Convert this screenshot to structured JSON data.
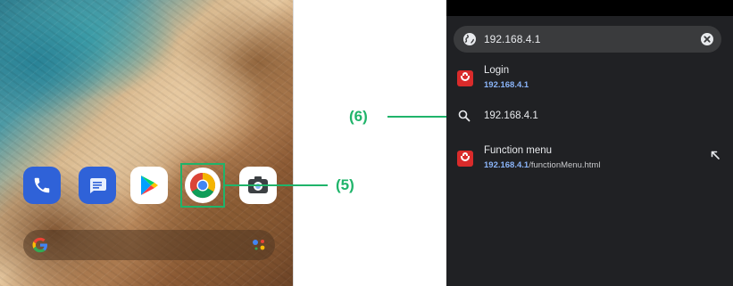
{
  "home": {
    "apps": [
      {
        "name": "Phone"
      },
      {
        "name": "Messages"
      },
      {
        "name": "Play Store"
      },
      {
        "name": "Chrome"
      },
      {
        "name": "Camera"
      }
    ]
  },
  "callouts": {
    "chrome_label": "(5)",
    "search_label": "(6)"
  },
  "browser": {
    "omnibox": {
      "value": "192.168.4.1"
    },
    "suggestions": [
      {
        "title": "Login",
        "url_bold": "192.168.4.1",
        "url_rest": ""
      },
      {
        "title": "192.168.4.1"
      },
      {
        "title": "Function menu",
        "url_bold": "192.168.4.1",
        "url_rest": "/functionMenu.html"
      }
    ]
  },
  "colors": {
    "callout": "#1fb46a",
    "browser_bg": "#202124",
    "url_highlight": "#8ab4f8"
  }
}
